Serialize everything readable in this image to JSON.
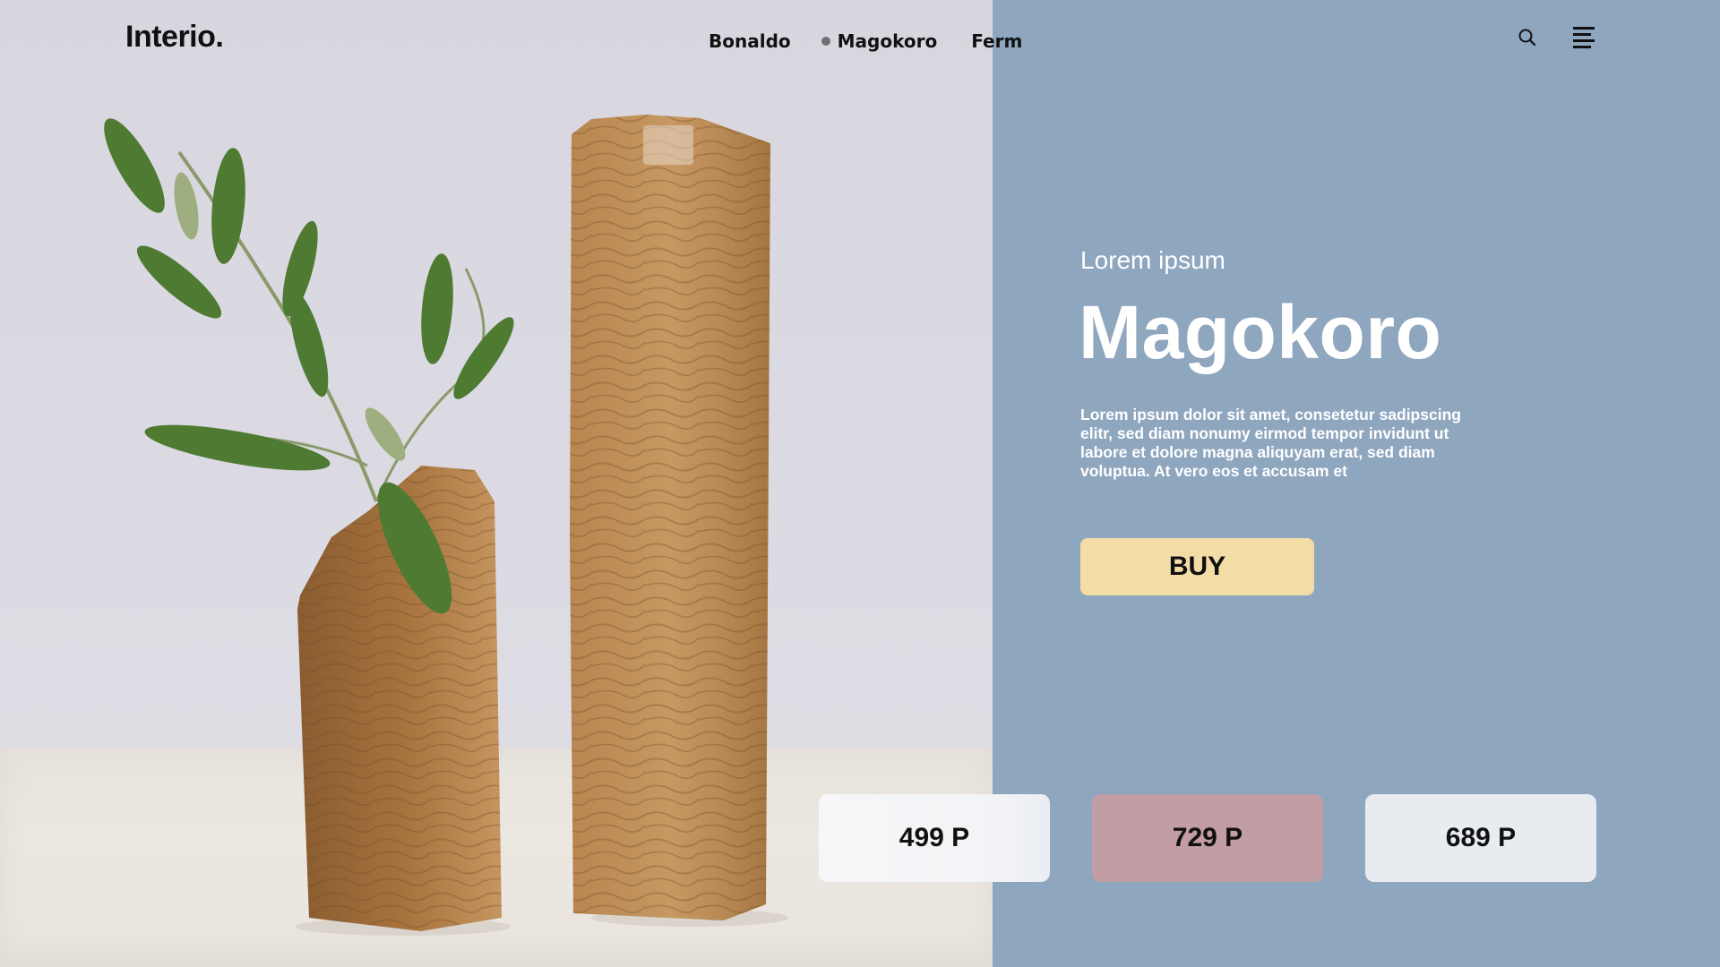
{
  "brand": {
    "logo": "Interio."
  },
  "nav": {
    "items": [
      {
        "label": "Bonaldo",
        "active": false
      },
      {
        "label": "Magokoro",
        "active": true
      },
      {
        "label": "Ferm",
        "active": false
      }
    ]
  },
  "header_actions": {
    "search_icon": "search-icon",
    "menu_icon": "menu-icon"
  },
  "product": {
    "eyebrow": "Lorem ipsum",
    "title": "Magokoro",
    "description": "Lorem ipsum dolor sit amet, consetetur sadipscing elitr, sed diam nonumy eirmod tempor invidunt ut labore et dolore magna aliquyam erat, sed diam voluptua. At vero eos et accusam et",
    "buy_label": "BUY"
  },
  "prices": [
    {
      "label": "499 P",
      "color": "#f2f3f6"
    },
    {
      "label": "729 P",
      "color": "#c29da3"
    },
    {
      "label": "689 P",
      "color": "#e8ebef"
    }
  ],
  "colors": {
    "panel": "#8fa6bf",
    "buy_button": "#f3dca6",
    "text_light": "#ffffff",
    "text_dark": "#111111"
  }
}
